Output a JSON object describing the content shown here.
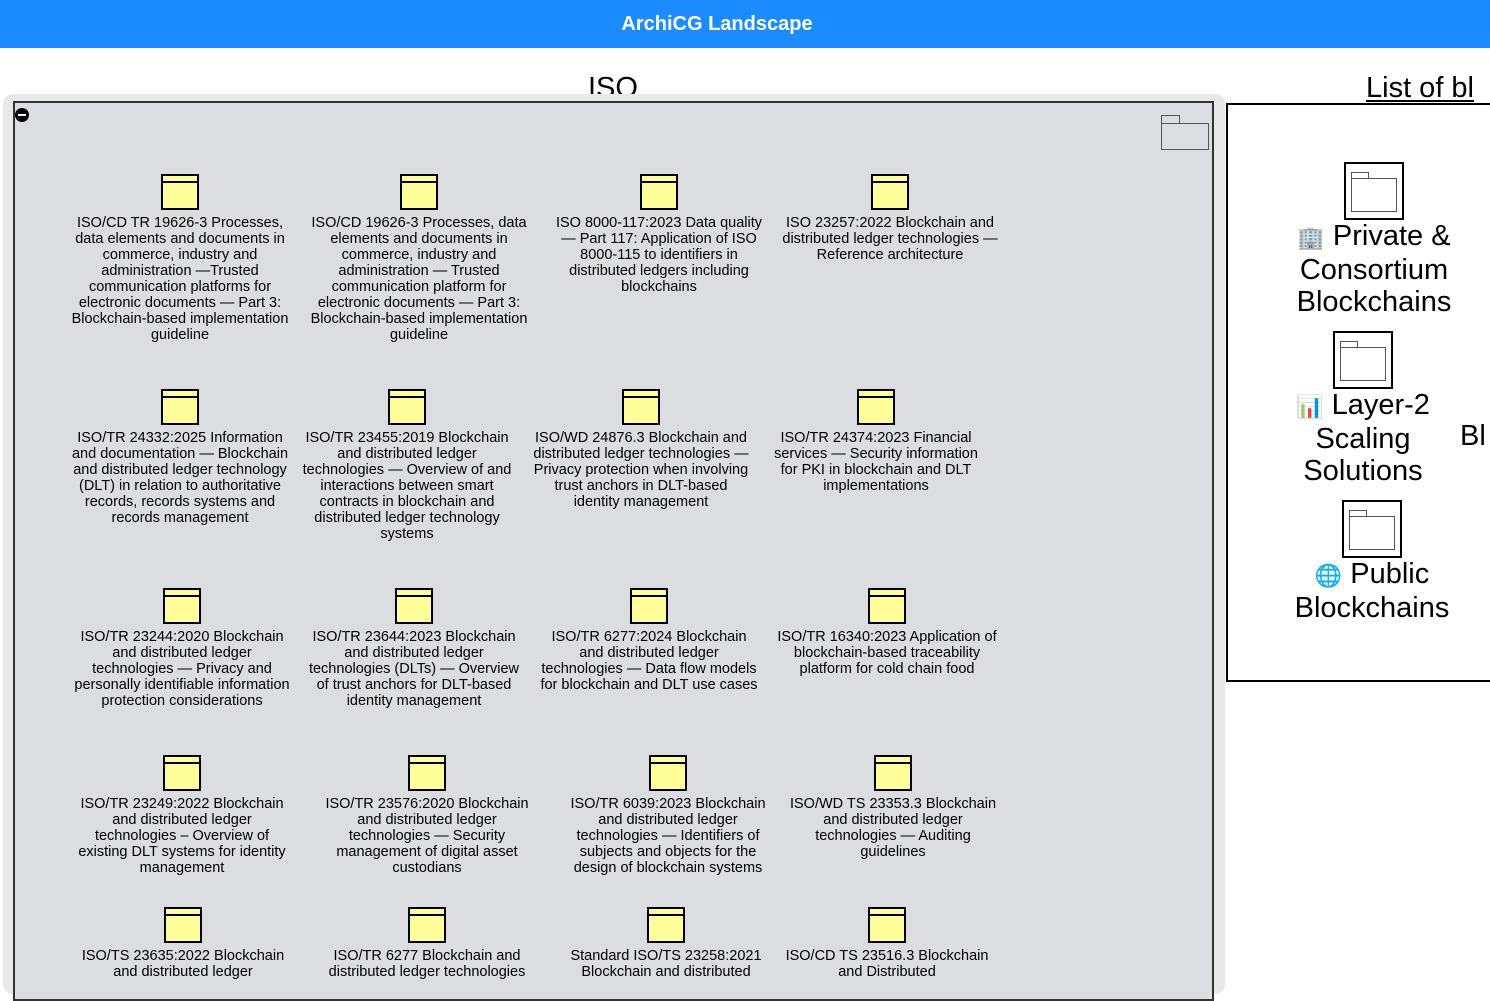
{
  "app": {
    "title": "ArchiCG Landscape"
  },
  "iso": {
    "title": "ISO",
    "items": [
      "ISO/CD TR 19626-3 Processes, data elements and documents in commerce, industry and administration —Trusted communication platforms for electronic documents — Part 3: Blockchain-based implementation guideline",
      "ISO/CD 19626-3 Processes, data elements and documents in commerce, industry and administration — Trusted communication platform for electronic documents — Part 3: Blockchain-based implementation guideline",
      "ISO 8000-117:2023 Data quality — Part 117: Application of ISO 8000-115 to identifiers in distributed ledgers including blockchains",
      "ISO 23257:2022 Blockchain and distributed ledger technologies — Reference architecture",
      "ISO/TR 24332:2025 Information and documentation — Blockchain and distributed ledger technology (DLT) in relation to authoritative records, records systems and records management",
      "ISO/TR 23455:2019 Blockchain and distributed ledger technologies — Overview of and interactions between smart contracts in blockchain and distributed ledger technology systems",
      "ISO/WD 24876.3 Blockchain and distributed ledger technologies — Privacy protection when involving trust anchors in DLT-based identity management",
      "ISO/TR 24374:2023 Financial services — Security information for PKI in blockchain and DLT implementations",
      "ISO/TR 23244:2020 Blockchain and distributed ledger technologies — Privacy and personally identifiable information protection considerations",
      "ISO/TR 23644:2023 Blockchain and distributed ledger technologies (DLTs) — Overview of trust anchors for DLT-based identity management",
      "ISO/TR 6277:2024 Blockchain and distributed ledger technologies — Data flow models for blockchain and DLT use cases",
      "ISO/TR 16340:2023 Application of blockchain-based traceability platform for cold chain food",
      "ISO/TR 23249:2022 Blockchain and distributed ledger technologies – Overview of existing DLT systems for identity management",
      "ISO/TR 23576:2020 Blockchain and distributed ledger technologies — Security management of digital asset custodians",
      "ISO/TR 6039:2023 Blockchain and distributed ledger technologies — Identifiers of subjects and objects for the design of blockchain systems",
      "ISO/WD TS 23353.3 Blockchain and distributed ledger technologies — Auditing guidelines",
      "ISO/TS 23635:2022 Blockchain and distributed ledger",
      "ISO/TR 6277 Blockchain and distributed ledger technologies",
      "Standard ISO/TS 23258:2021 Blockchain and distributed",
      "ISO/CD TS 23516.3 Blockchain and Distributed"
    ]
  },
  "list_panel": {
    "title": "List of bl",
    "groups": [
      {
        "emoji": "🏢",
        "label_lines": [
          "Private &",
          "Consortium",
          "Blockchains"
        ]
      },
      {
        "emoji": "📊",
        "label_lines": [
          "Layer-2",
          "Scaling",
          "Solutions"
        ]
      },
      {
        "emoji": "🌐",
        "label_lines": [
          "Public",
          "Blockchains"
        ]
      }
    ],
    "partial_text": "Bl"
  }
}
